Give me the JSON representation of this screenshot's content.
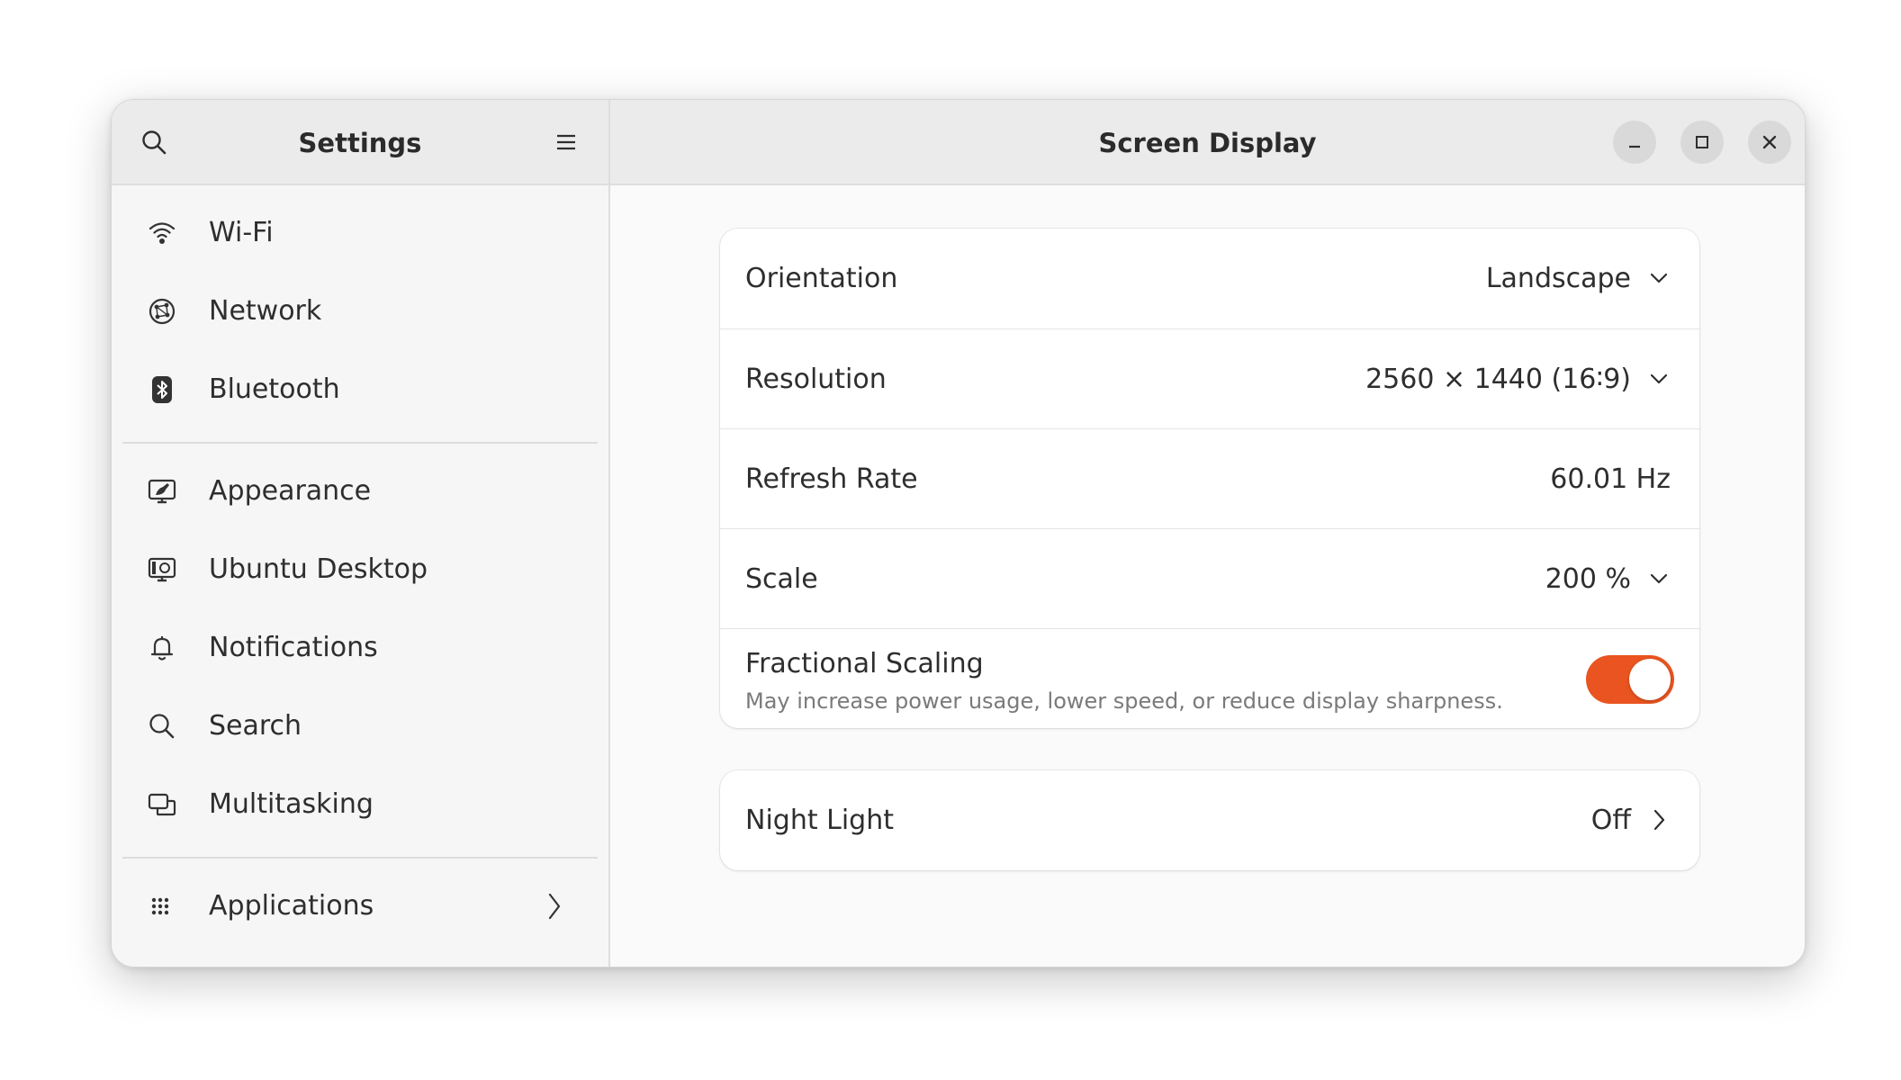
{
  "sidebar": {
    "title": "Settings",
    "items": [
      {
        "label": "Wi-Fi",
        "icon": "wifi-icon"
      },
      {
        "label": "Network",
        "icon": "network-icon"
      },
      {
        "label": "Bluetooth",
        "icon": "bluetooth-icon"
      },
      {
        "label": "Appearance",
        "icon": "appearance-icon"
      },
      {
        "label": "Ubuntu Desktop",
        "icon": "ubuntu-desktop-icon"
      },
      {
        "label": "Notifications",
        "icon": "bell-icon"
      },
      {
        "label": "Search",
        "icon": "search-icon"
      },
      {
        "label": "Multitasking",
        "icon": "multitasking-icon"
      },
      {
        "label": "Applications",
        "icon": "grid-icon"
      }
    ]
  },
  "main": {
    "title": "Screen Display",
    "display_card": {
      "orientation": {
        "label": "Orientation",
        "value": "Landscape"
      },
      "resolution": {
        "label": "Resolution",
        "value": "2560 × 1440 (16∶9)"
      },
      "refresh_rate": {
        "label": "Refresh Rate",
        "value": "60.01 Hz"
      },
      "scale": {
        "label": "Scale",
        "value": "200 %"
      },
      "fractional_scaling": {
        "label": "Fractional Scaling",
        "description": "May increase power usage, lower speed, or reduce display sharpness.",
        "enabled": true
      }
    },
    "night_light": {
      "label": "Night Light",
      "value": "Off"
    }
  },
  "colors": {
    "accent": "#e95420",
    "header_bg": "#ebebeb",
    "sidebar_bg": "#f6f6f6",
    "content_bg": "#fafafa",
    "card_bg": "#ffffff"
  }
}
